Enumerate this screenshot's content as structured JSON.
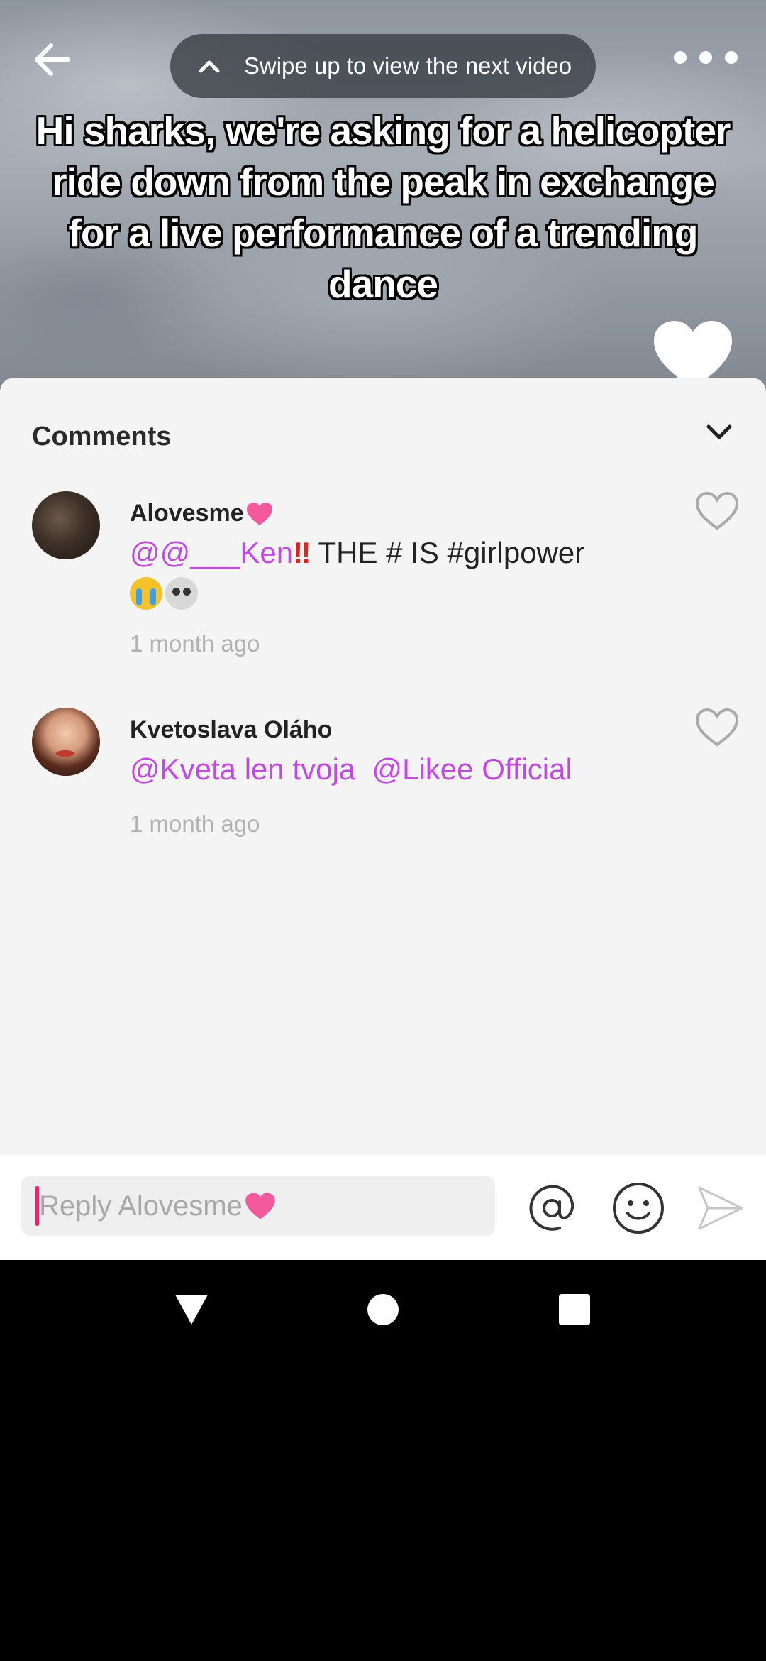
{
  "video": {
    "swipe_hint": "Swipe up to view the next video",
    "caption": "Hi sharks, we're asking for a helicopter ride down from the peak in exchange for a live performance of a trending dance",
    "icons": {
      "back": "arrow-left-icon",
      "more": "more-dots-icon",
      "swipe": "chevron-up-icon",
      "like": "heart-icon"
    }
  },
  "comments_panel": {
    "title": "Comments",
    "collapse_icon": "chevron-down-icon",
    "comments": [
      {
        "username": "Alovesme",
        "username_emoji": "pink-heart",
        "mention": "@@___Ken",
        "emoji_bang": "‼",
        "text": "THE # IS #girlpower",
        "emojis": [
          "crying-face",
          "skull"
        ],
        "time": "1 month ago"
      },
      {
        "username": "Kvetoslava Oláho",
        "mention_1": "@Kveta len tvoja",
        "mention_2": "@Likee Official",
        "time": "1 month ago"
      }
    ]
  },
  "input_bar": {
    "placeholder": "Reply Alovesme",
    "placeholder_emoji": "pink-heart",
    "icons": [
      "at-icon",
      "smiley-icon",
      "send-icon"
    ]
  },
  "system_nav": {
    "icons": [
      "nav-back-icon",
      "nav-home-icon",
      "nav-recent-apps-icon"
    ]
  },
  "colors": {
    "mention": "#c14ae0",
    "caret": "#e6296e",
    "timestamp": "#b2b2b2",
    "sheet_bg": "#f4f4f5"
  }
}
